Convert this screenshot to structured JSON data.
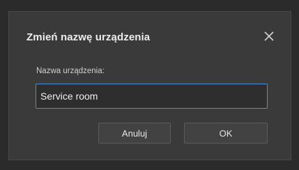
{
  "dialog": {
    "title": "Zmień nazwę urządzenia",
    "close_icon": "close-icon",
    "field_label": "Nazwa urządzenia:",
    "field_value": "Service room",
    "cancel_label": "Anuluj",
    "ok_label": "OK"
  },
  "colors": {
    "background": "#2b2b2b",
    "dialog": "#3a3a3a",
    "input_border_focus": "#4b8fd8",
    "text": "#ededed"
  }
}
